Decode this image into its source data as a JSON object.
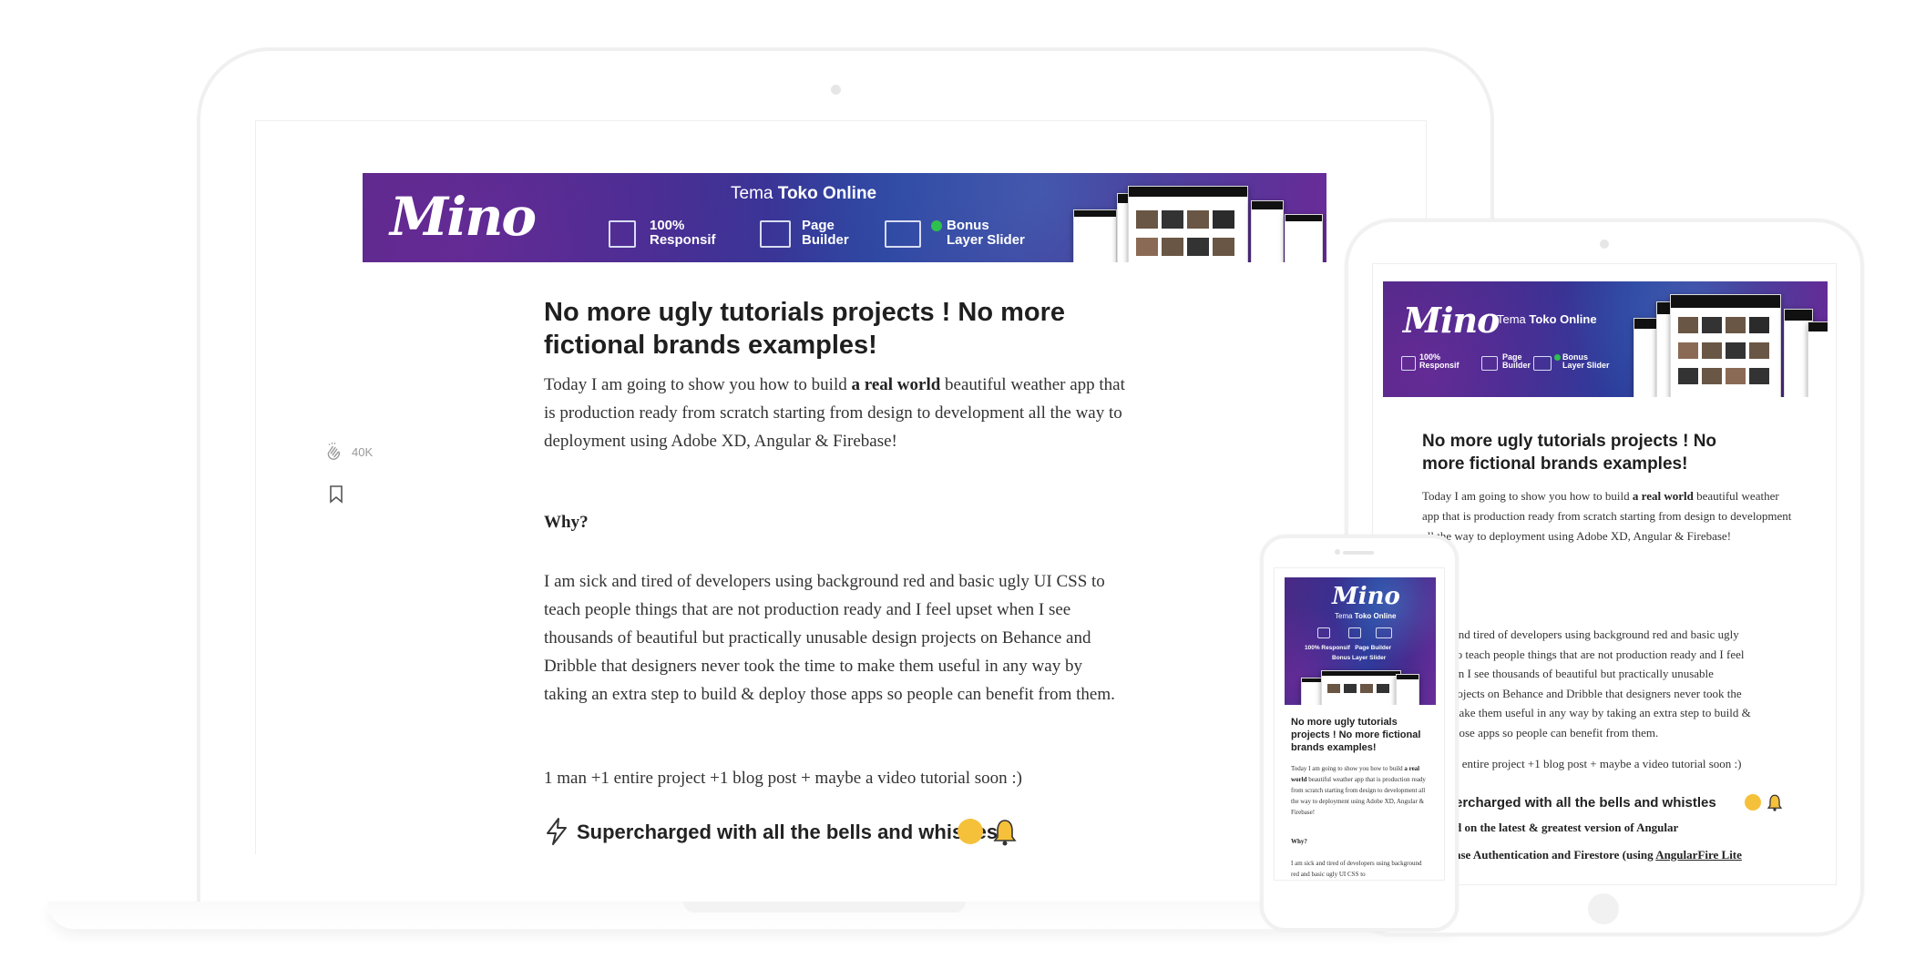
{
  "banner": {
    "logo": "Mino",
    "title_prefix": "Tema",
    "title_bold": "Toko Online",
    "feature_responsive_line1": "100%",
    "feature_responsive_line2": "Responsif",
    "feature_builder_line1": "Page",
    "feature_builder_line2": "Builder",
    "feature_bonus_line1": "Bonus",
    "feature_bonus_line2": "Layer Slider",
    "phone_feature_responsive": "100% Responsif",
    "phone_feature_builder": "Page Builder",
    "phone_feature_bonus": "Bonus Layer Slider"
  },
  "sidebar": {
    "claps_count": "40K",
    "clap_icon": "clap-icon",
    "bookmark_icon": "bookmark-icon"
  },
  "article": {
    "title": "No more ugly tutorials projects ! No more fictional brands examples!",
    "intro_before_bold": "Today I am going to show you how to build ",
    "intro_bold": "a real world",
    "intro_after_bold": " beautiful weather app that is production ready from scratch starting from design to development all the way to deployment using Adobe XD, Angular & Firebase!",
    "why_heading": "Why?",
    "why_paragraph": "I am sick and tired of developers using background red and basic ugly UI CSS to teach people things that are not production ready and I feel upset when I see thousands of beautiful but practically unusable design projects on Behance and Dribble that designers never took the time to make them useful in any way by taking an extra step to build & deploy those apps so people can benefit from them.",
    "formula": "1 man +1 entire project +1 blog post + maybe a video tutorial soon :)",
    "section_heading": "Supercharged with all the bells and whistles",
    "tablet_partial": {
      "why_lines": [
        " and tired of developers using background red and basic ugly",
        " to teach people things that are not production ready and I feel",
        "en I see thousands of beautiful but practically unusable",
        "rojects on Behance and Dribble that designers never took the",
        "nake them useful in any way by taking an extra step to build &",
        "hose apps so people can benefit from them."
      ],
      "formula": " 1 entire project +1 blog post + maybe a video tutorial soon :)",
      "section_heading": "ercharged with all the bells and whistles",
      "bullet1": "d on the latest & greatest version of Angular",
      "bullet2_prefix": "ase Authentication and Firestore (using ",
      "bullet2_link": "AngularFire Lite"
    },
    "phone_partial": {
      "why_text": "I am sick and tired of developers using background red and basic ugly UI CSS to"
    }
  }
}
